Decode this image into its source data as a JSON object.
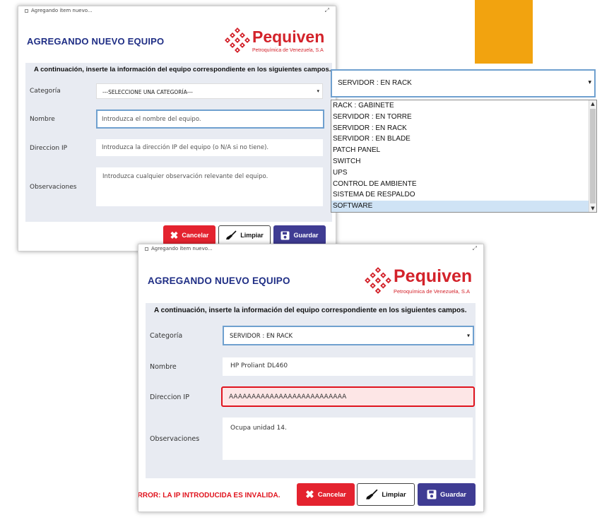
{
  "colors": {
    "accent": "#f2a30f",
    "title_blue": "#1f2e85",
    "brand_red": "#d3222a",
    "cancel_red": "#e4232f",
    "save_blue": "#3f3c93",
    "error_red": "#e0141e",
    "focus_blue": "#6fa0cf"
  },
  "window1": {
    "titlebar": "Agregando ítem nuevo...",
    "title": "AGREGANDO NUEVO EQUIPO",
    "logo": {
      "name": "Pequiven",
      "tagline": "Petroquímica de Venezuela, S.A"
    },
    "intro": "A continuación, inserte la información del equipo correspondiente en los siguientes campos.",
    "labels": {
      "category": "Categoría",
      "name": "Nombre",
      "ip": "Direccion IP",
      "notes": "Observaciones"
    },
    "category_value": "---SELECCIONE UNA CATEGORÍA---",
    "placeholders": {
      "name": "Introduzca el nombre del equipo.",
      "ip": "Introduzca la dirección IP del equipo (o N/A si no tiene).",
      "notes": "Introduzca cualquier observación relevante del equipo."
    },
    "buttons": {
      "cancel": "Cancelar",
      "clear": "Limpiar",
      "save": "Guardar"
    }
  },
  "dropdown": {
    "selected": "SERVIDOR : EN RACK",
    "options": [
      "RACK : GABINETE",
      "SERVIDOR : EN TORRE",
      "SERVIDOR : EN RACK",
      "SERVIDOR : EN BLADE",
      "PATCH PANEL",
      "SWITCH",
      "UPS",
      "CONTROL DE AMBIENTE",
      "SISTEMA DE RESPALDO",
      "SOFTWARE"
    ],
    "highlighted_index": 9
  },
  "window2": {
    "titlebar": "Agregando ítem nuevo...",
    "title": "AGREGANDO NUEVO EQUIPO",
    "logo": {
      "name": "Pequiven",
      "tagline": "Petroquímica de Venezuela, S.A"
    },
    "intro": "A continuación, inserte la información del equipo correspondiente en los siguientes campos.",
    "labels": {
      "category": "Categoría",
      "name": "Nombre",
      "ip": "Direccion IP",
      "notes": "Observaciones"
    },
    "values": {
      "category": "SERVIDOR : EN RACK",
      "name": "HP Proliant DL460",
      "ip": "AAAAAAAAAAAAAAAAAAAAAAAAAA",
      "notes": "Ocupa unidad 14."
    },
    "error": "ERROR: LA IP INTRODUCIDA ES INVÁLIDA.",
    "buttons": {
      "cancel": "Cancelar",
      "clear": "Limpiar",
      "save": "Guardar"
    }
  }
}
